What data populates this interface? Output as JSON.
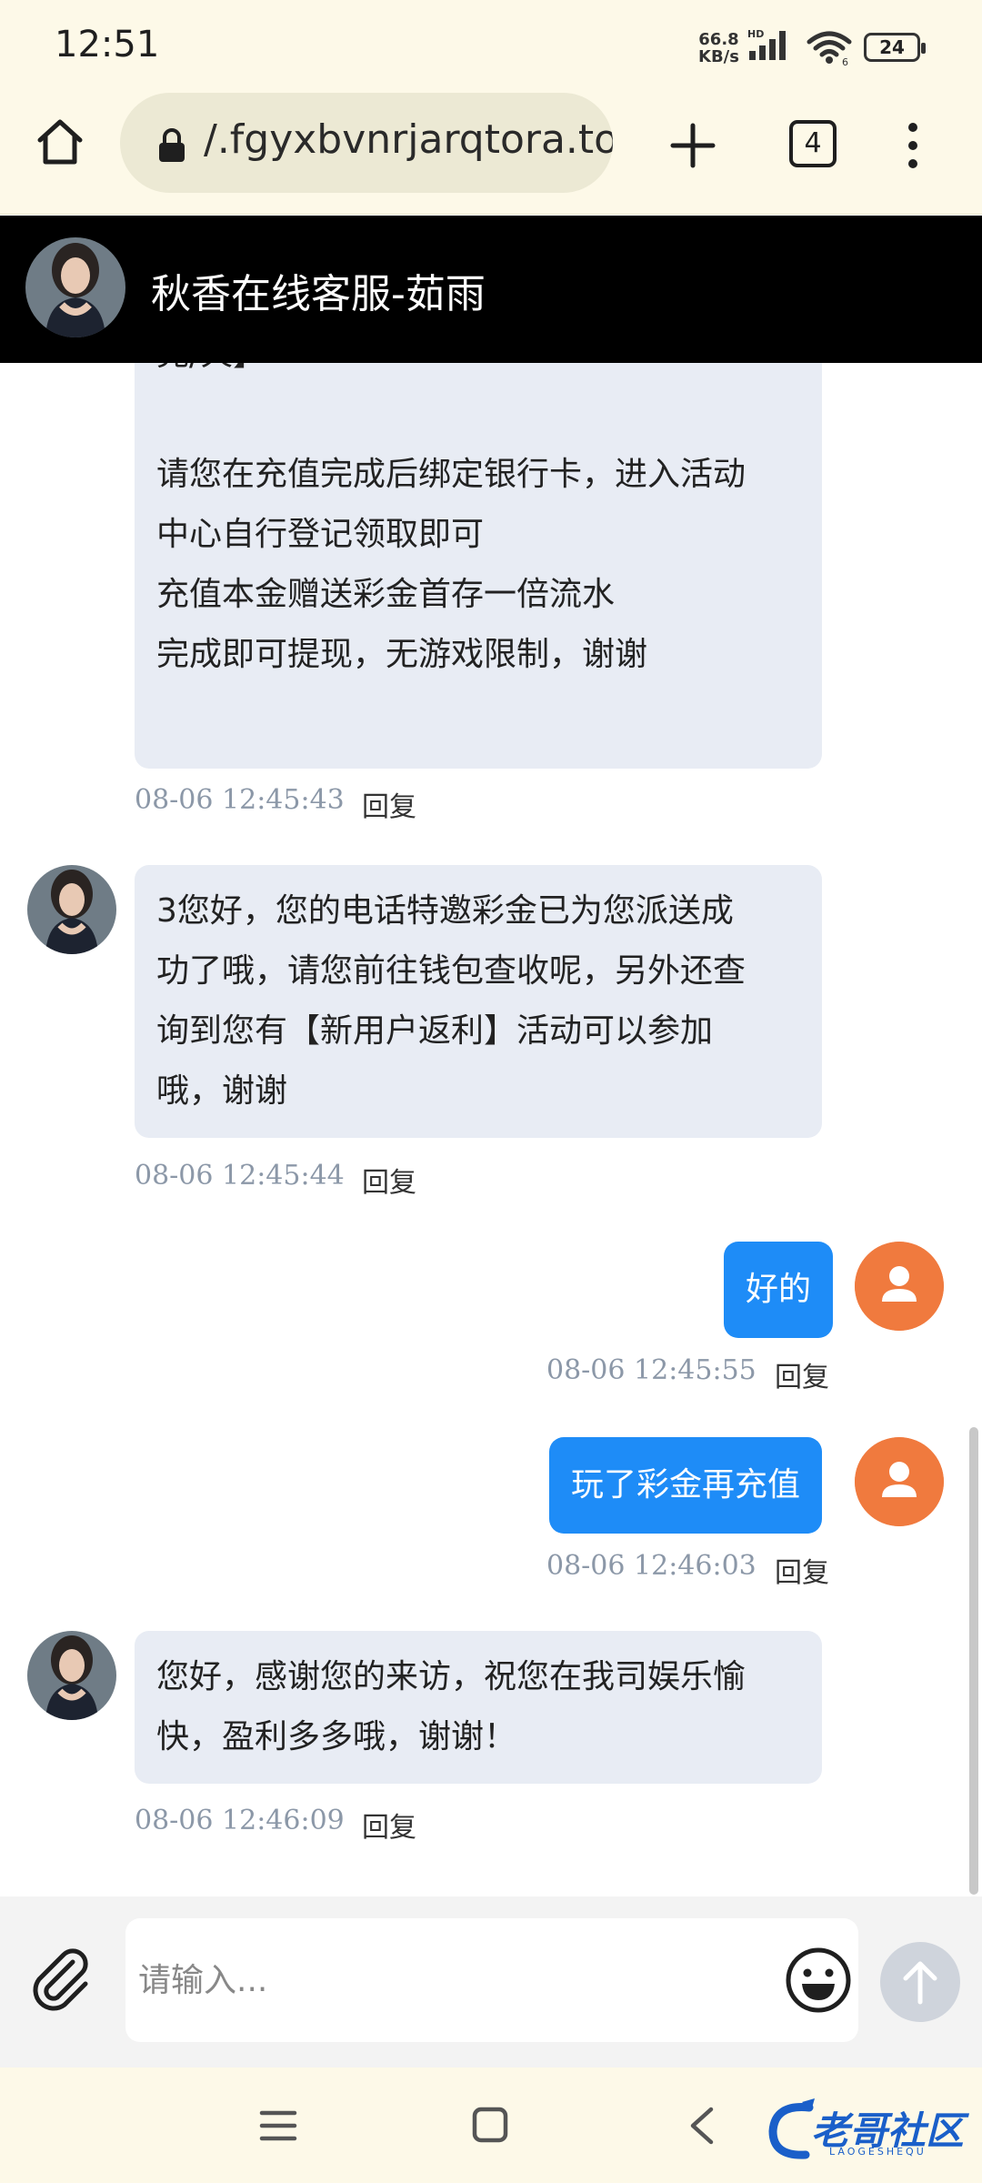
{
  "status_bar": {
    "time": "12:51",
    "net_speed_value": "66.8",
    "net_speed_unit": "KB/s",
    "battery": "24"
  },
  "browser": {
    "url": "/.fgyxbvnrjarqtora.top",
    "tab_count": "4"
  },
  "chat_header": {
    "title": "秋香在线客服-茹雨"
  },
  "messages": [
    {
      "side": "in",
      "lines": [
        "完/火】",
        "",
        "",
        "请您在充值完成后绑定银行卡，进入活动",
        "中心自行登记领取即可",
        "充值本金赠送彩金首存一倍流水",
        "完成即可提现，无游戏限制，谢谢"
      ],
      "time": "08-06 12:45:43",
      "reply": "回复"
    },
    {
      "side": "in",
      "lines": [
        "3您好，您的电话特邀彩金已为您派送成",
        "功了哦，请您前往钱包查收呢，另外还查",
        "询到您有【新用户返利】活动可以参加",
        "哦，谢谢"
      ],
      "time": "08-06 12:45:44",
      "reply": "回复"
    },
    {
      "side": "out",
      "text": "好的",
      "time": "08-06 12:45:55",
      "reply": "回复"
    },
    {
      "side": "out",
      "text": "玩了彩金再充值",
      "time": "08-06 12:46:03",
      "reply": "回复"
    },
    {
      "side": "in",
      "lines": [
        "您好，感谢您的来访，祝您在我司娱乐愉",
        "快，盈利多多哦，谢谢！"
      ],
      "time": "08-06 12:46:09",
      "reply": "回复"
    }
  ],
  "input": {
    "placeholder": "请输入..."
  },
  "watermark": {
    "text": "老哥社区",
    "subtext": "LAOGESHEQU"
  },
  "colors": {
    "header_bg": "#000000",
    "incoming_bubble": "#e8ecf4",
    "outgoing_bubble": "#1e8cf7",
    "user_avatar": "#f07a3e",
    "browser_bg": "#fdf9e8"
  },
  "icons": {
    "home": "home-icon",
    "lock": "lock-icon",
    "new_tab": "plus-icon",
    "menu": "more-vert-icon",
    "attach": "paperclip-icon",
    "emoji": "smiley-icon",
    "send": "arrow-up-icon",
    "user": "user-icon"
  }
}
